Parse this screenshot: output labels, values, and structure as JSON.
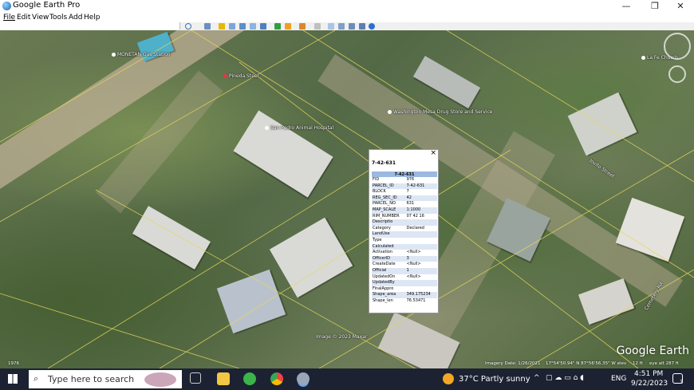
{
  "window": {
    "title": "Google Earth Pro",
    "minimize": "—",
    "maximize": "❐",
    "close": "✕"
  },
  "menu": [
    "File",
    "Edit",
    "View",
    "Tools",
    "Add",
    "Help"
  ],
  "toolbar_icons": [
    "search-icon",
    "sidebar-toggle-icon",
    "placemark-icon",
    "polygon-icon",
    "path-icon",
    "image-overlay-icon",
    "record-tour-icon",
    "historical-imagery-icon",
    "sun-icon",
    "planets-icon",
    "ruler-icon",
    "email-icon",
    "print-icon",
    "save-image-icon",
    "maps-icon",
    "earth-icon"
  ],
  "map": {
    "places": [
      {
        "name": "MONETAN Gas Station",
        "icon": "place-marker-icon"
      },
      {
        "name": "Pineda Steel",
        "icon": "place-marker-icon"
      },
      {
        "name": "Washington Mesa Drug Store and Service",
        "icon": "place-marker-icon"
      },
      {
        "name": "San Pedro Animal Hospital",
        "icon": "place-marker-icon"
      },
      {
        "name": "La Fe Church",
        "icon": "place-marker-icon"
      }
    ],
    "street_label": "Jovito Street",
    "road_label_2": "Cemetery Rd",
    "image_credit": "Image © 2023 Maxar",
    "imagery_date": "Imagery Date: 1/26/2021",
    "coordinates": "17°54'50.94\" N  87°56'56.35\" W  elev",
    "elevation": "12 ft",
    "eye_alt": "eye alt  287 ft",
    "scale_label": "1976",
    "logo": "Google Earth"
  },
  "balloon": {
    "close": "×",
    "title": "7-42-631",
    "table_header": "7-42-631",
    "rows": [
      {
        "k": "FID",
        "v": "976"
      },
      {
        "k": "PARCEL_ID",
        "v": "7-42-631"
      },
      {
        "k": "BLOCK",
        "v": "7"
      },
      {
        "k": "REG_SEC_ID",
        "v": "42"
      },
      {
        "k": "PARCEL_NO",
        "v": "631"
      },
      {
        "k": "MAP_SCALE",
        "v": "1:1000"
      },
      {
        "k": "RIM_NUMBER",
        "v": "07 42 16"
      },
      {
        "k": "Descriptio",
        "v": ""
      },
      {
        "k": "Category",
        "v": "Declared"
      },
      {
        "k": "LandUse",
        "v": ""
      },
      {
        "k": "Type",
        "v": ""
      },
      {
        "k": "Calculated",
        "v": ""
      },
      {
        "k": "Activation",
        "v": "<Null>"
      },
      {
        "k": "OfficerID",
        "v": "3"
      },
      {
        "k": "CreateDate",
        "v": "<Null>"
      },
      {
        "k": "Official",
        "v": "1"
      },
      {
        "k": "UpdatedOn",
        "v": "<Null>"
      },
      {
        "k": "UpdatedBy",
        "v": ""
      },
      {
        "k": "FinalAppro",
        "v": ""
      },
      {
        "k": "Shape_area",
        "v": "349.175234"
      },
      {
        "k": "Shape_len",
        "v": "76.53471"
      }
    ]
  },
  "taskbar": {
    "search_placeholder": "Type here to search",
    "weather": "37°C  Partly sunny",
    "language": "ENG",
    "time": "4:51 PM",
    "date": "9/22/2023",
    "notification_count": "3"
  }
}
